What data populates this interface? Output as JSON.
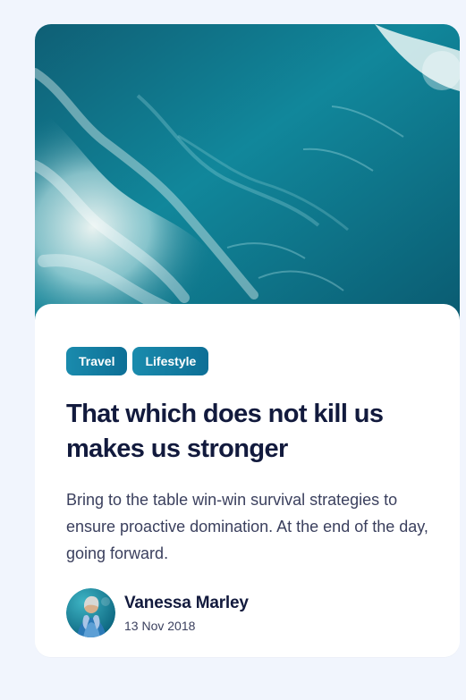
{
  "card": {
    "tags": [
      "Travel",
      "Lifestyle"
    ],
    "title": "That which does not kill us makes us stronger",
    "excerpt": "Bring to the table win-win survival strategies to ensure proactive domination. At the end of the day, going forward.",
    "author": {
      "name": "Vanessa Marley",
      "date": "13 Nov 2018"
    }
  },
  "icons": {
    "hero": "ocean-aerial-image",
    "avatar": "person-portrait-image"
  },
  "colors": {
    "page_background": "#f1f5fd",
    "card_background": "#ffffff",
    "title": "#121a3d",
    "body_text": "#3b405e",
    "tag_gradient_start": "#1a8bad",
    "tag_gradient_end": "#0d6f96"
  }
}
